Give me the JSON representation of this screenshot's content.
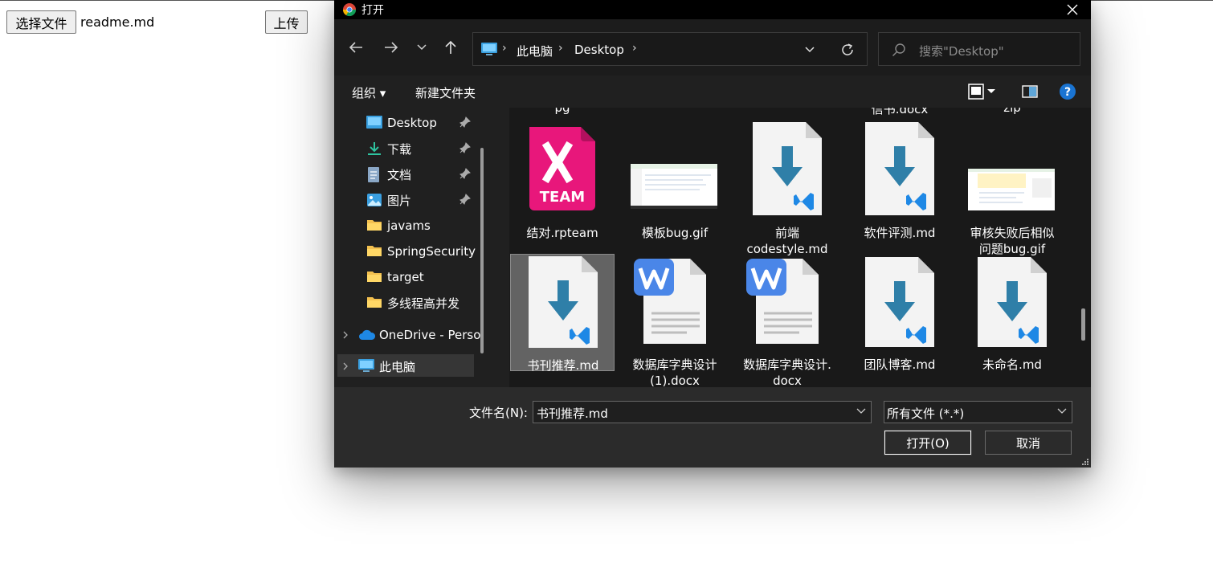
{
  "page": {
    "choose_label": "选择文件",
    "file_name": "readme.md",
    "upload_label": "上传"
  },
  "dialog": {
    "title": "打开",
    "breadcrumb": [
      "此电脑",
      "Desktop"
    ],
    "search_placeholder": "搜索\"Desktop\"",
    "toolbar": {
      "organize": "组织 ▾",
      "new_folder": "新建文件夹"
    },
    "sidebar": [
      {
        "label": "Desktop",
        "icon": "desktop-icon",
        "pinned": true
      },
      {
        "label": "下载",
        "icon": "download-icon",
        "pinned": true
      },
      {
        "label": "文档",
        "icon": "document-icon",
        "pinned": true
      },
      {
        "label": "图片",
        "icon": "picture-icon",
        "pinned": true
      },
      {
        "label": "javams",
        "icon": "folder-icon",
        "pinned": false
      },
      {
        "label": "SpringSecurity",
        "icon": "folder-icon",
        "pinned": false
      },
      {
        "label": "target",
        "icon": "folder-icon",
        "pinned": false
      },
      {
        "label": "多线程高并发",
        "icon": "folder-icon",
        "pinned": false
      },
      {
        "label": "OneDrive - Perso",
        "icon": "cloud-icon",
        "pinned": false
      },
      {
        "label": "此电脑",
        "icon": "pc-icon",
        "pinned": false
      }
    ],
    "cut_labels": [
      "pg",
      "信书.docx",
      "zip"
    ],
    "files": [
      {
        "name": "结对.rpteam",
        "type": "rpteam",
        "icon_text": "TEAM"
      },
      {
        "name": "模板bug.gif",
        "type": "gif-screenshot"
      },
      {
        "name": "前端\ncodestyle.md",
        "type": "md"
      },
      {
        "name": "软件评测.md",
        "type": "md"
      },
      {
        "name": "审核失败后相似\n问题bug.gif",
        "type": "gif-screenshot"
      },
      {
        "name": "书刊推荐.md",
        "type": "md",
        "selected": true
      },
      {
        "name": "数据库字典设计\n(1).docx",
        "type": "docx"
      },
      {
        "name": "数据库字典设计.\ndocx",
        "type": "docx"
      },
      {
        "name": "团队博客.md",
        "type": "md"
      },
      {
        "name": "未命名.md",
        "type": "md"
      }
    ],
    "footer": {
      "filename_label": "文件名(N):",
      "filename_value": "书刊推荐.md",
      "filetype_value": "所有文件 (*.*)",
      "open_label": "打开(O)",
      "cancel_label": "取消"
    },
    "colors": {
      "md_arrow": "#2f7fa8",
      "vscode_blue": "#1e88e5",
      "word_blue": "#4a86e8",
      "rpteam_pink": "#e8177b"
    }
  }
}
